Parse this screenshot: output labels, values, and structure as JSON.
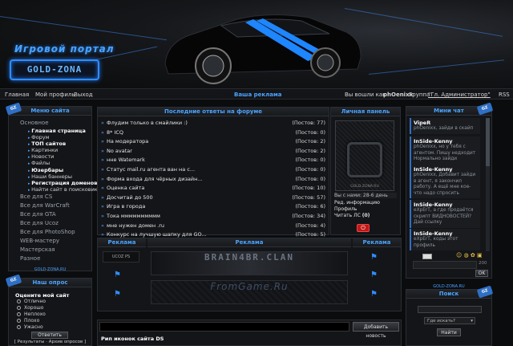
{
  "header": {
    "logo_title": "Игровой портал",
    "logo_text": "GOLD-ZONA"
  },
  "topnav": {
    "home": "Главная",
    "profile": "Мой профиль",
    "logout": "Выход",
    "ad": "Ваша реклама",
    "logged_in_as": "Вы вошли как",
    "username": "phOenixx",
    "group_label": "Группа",
    "group": "\"Гл. Администратор\"",
    "rss": "RSS"
  },
  "menu": {
    "title": "Меню сайта",
    "tag": "GZ",
    "items": [
      {
        "label": "Основное",
        "type": "top"
      },
      {
        "label": "Главная страница",
        "type": "sub-bold"
      },
      {
        "label": "Форум",
        "type": "sub"
      },
      {
        "label": "ТОП сайтов",
        "type": "sub-bold"
      },
      {
        "label": "Картинки",
        "type": "sub"
      },
      {
        "label": "Новости",
        "type": "sub"
      },
      {
        "label": "Файлы",
        "type": "sub"
      },
      {
        "label": "Юзербары",
        "type": "sub-bold"
      },
      {
        "label": "Наши баннеры",
        "type": "sub"
      },
      {
        "label": "Регистрация доменов",
        "type": "sub-bold"
      },
      {
        "label": "Найти сайт в поисковике",
        "type": "sub"
      },
      {
        "label": "Все для CS",
        "type": "top"
      },
      {
        "label": "Все для WarCraft",
        "type": "top"
      },
      {
        "label": "Все для GTA",
        "type": "top"
      },
      {
        "label": "Все для Ucoz",
        "type": "top"
      },
      {
        "label": "Все для PhotoShop",
        "type": "top"
      },
      {
        "label": "WEB-мастеру",
        "type": "top"
      },
      {
        "label": "Мастерская",
        "type": "top"
      },
      {
        "label": "Разное",
        "type": "top"
      }
    ],
    "footer": "GOLD-ZONA.RU"
  },
  "poll": {
    "title": "Наш опрос",
    "tag": "GZ",
    "question": "Оцените мой сайт",
    "options": [
      "Отлично",
      "Хорошо",
      "Неплохо",
      "Плохо",
      "Ужасно"
    ],
    "vote_button": "Ответить",
    "results": "[ Результаты · Архив опросов ]"
  },
  "forum": {
    "title": "Последние ответы на форуме",
    "posts": [
      {
        "title": "Флудим только в смайлики :)",
        "count": "(Постов: 77)"
      },
      {
        "title": "8* ICQ",
        "count": "(Постов: 0)"
      },
      {
        "title": "На модератора",
        "count": "(Постов: 2)"
      },
      {
        "title": "No avatar",
        "count": "(Постов: 2)"
      },
      {
        "title": "нне Watemark",
        "count": "(Постов: 0)"
      },
      {
        "title": "Статус mail.ru агента ван на с...",
        "count": "(Постов: 0)"
      },
      {
        "title": "Форма входа для чёрных дизайн...",
        "count": "(Постов: 0)"
      },
      {
        "title": "Оценка сайта",
        "count": "(Постов: 10)"
      },
      {
        "title": "Досчитай до 500",
        "count": "(Постов: 57)"
      },
      {
        "title": "Игра в города",
        "count": "(Постов: 6)"
      },
      {
        "title": "Тока мммммммммм",
        "count": "(Постов: 34)"
      },
      {
        "title": "мне нужен домен .ru",
        "count": "(Постов: 4)"
      },
      {
        "title": "Конкурс на лучшую шапку для GO...",
        "count": "(Постов: 5)"
      },
      {
        "title": "Форма заявки",
        "count": "(Постов: 2)"
      }
    ]
  },
  "personal": {
    "title": "Личная панель",
    "avatar_caption": "GOLD-ZONA.RU",
    "registered": "Вы с нами: 28-6 день",
    "edit": "Ред. информацию",
    "profile": "Профиль",
    "pm_label": "Читать ЛС",
    "pm_count": "(0)"
  },
  "ads": {
    "left_title": "Реклама",
    "center_title": "Реклама",
    "right_title": "Реклама",
    "banner_small": "UCOZ PS",
    "banner_top": "BRAIN4BR.CLAN",
    "banner_bottom": "FromGame.Ru"
  },
  "news": {
    "add_button": "Добавить новость",
    "item_title": "Рип иконок сайта DS"
  },
  "chat": {
    "title": "Мини чат",
    "tag": "GZ",
    "messages": [
      {
        "name": "VipeR",
        "text": "phOenixx, зайди в скайп"
      },
      {
        "name": "InSide-Kenny",
        "text": "phOenixx, но у тебя с агентом. Пишу недходит Нормально зайди"
      },
      {
        "name": "InSide-Kenny",
        "text": "phOenixx, Добавит зайди в агент, я закончил работу. А ещё мне кое-что надо спросить"
      },
      {
        "name": "InSide-Kenny",
        "text": "eXpErT, а где продаётся скрипт ВИДНОВОСТЕЙ? Дай ссылку"
      },
      {
        "name": "InSide-Kenny",
        "text": "eXpErT, коды этот профиль"
      }
    ],
    "counter": "200",
    "ok_button": "OK",
    "footer": "GOLD-ZONA.RU"
  },
  "search": {
    "title": "Поиск",
    "tag": "GZ",
    "where_placeholder": "Где искать?",
    "find_button": "Найти"
  },
  "colors": {
    "accent": "#4aa3ff",
    "background": "#0b0c0e",
    "panel": "#141518"
  }
}
